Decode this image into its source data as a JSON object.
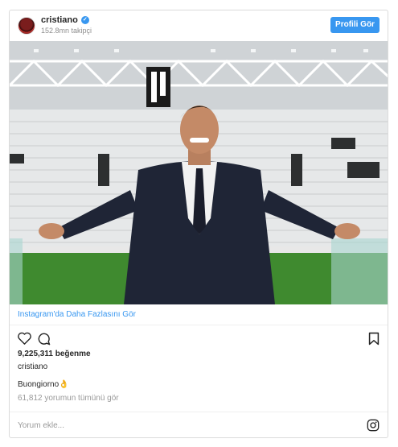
{
  "header": {
    "username": "cristiano",
    "verified_icon": "verified-badge-icon",
    "followers": "152.8mn takipçi",
    "profile_button": "Profili Gör"
  },
  "photo": {
    "description_icon": "photo"
  },
  "more_link": "Instagram'da Daha Fazlasını Gör",
  "actions": {
    "like_icon": "heart-icon",
    "comment_icon": "comment-icon",
    "save_icon": "bookmark-icon"
  },
  "likes": "9,225,311 beğenme",
  "caption_user": "cristiano",
  "caption": "Buongiorno👌",
  "comments_link": "61,812 yorumun tümünü gör",
  "comment_box": {
    "placeholder": "Yorum ekle..."
  },
  "colors": {
    "accent": "#3897f0",
    "text": "#262626",
    "muted": "#999999",
    "border": "#dbdbdb"
  }
}
